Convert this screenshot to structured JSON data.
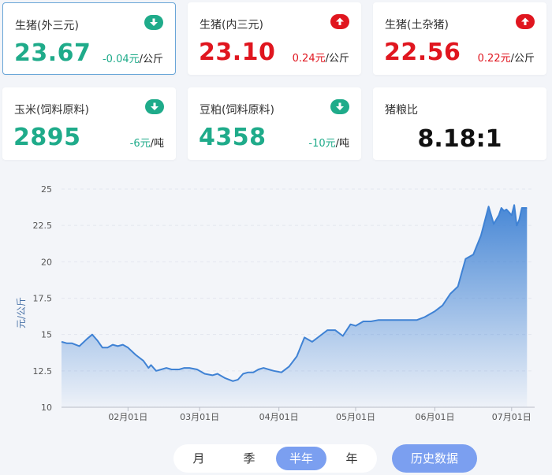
{
  "cards": [
    {
      "name": "生猪(外三元)",
      "value": "23.67",
      "change": "-0.04元",
      "unit": "/公斤",
      "trend": "down",
      "icon": "down-arrow-icon"
    },
    {
      "name": "生猪(内三元)",
      "value": "23.10",
      "change": "0.24元",
      "unit": "/公斤",
      "trend": "up",
      "icon": "up-arrow-icon"
    },
    {
      "name": "生猪(土杂猪)",
      "value": "22.56",
      "change": "0.22元",
      "unit": "/公斤",
      "trend": "up",
      "icon": "up-arrow-icon"
    },
    {
      "name": "玉米(饲料原料)",
      "value": "2895",
      "change": "-6元",
      "unit": "/吨",
      "trend": "down",
      "icon": "down-arrow-icon"
    },
    {
      "name": "豆粕(饲料原料)",
      "value": "4358",
      "change": "-10元",
      "unit": "/吨",
      "trend": "down",
      "icon": "down-arrow-icon"
    },
    {
      "name": "猪粮比",
      "value": "8.18:1"
    }
  ],
  "colors": {
    "up": "#e0161f",
    "down": "#1fab8a",
    "line": "#3f82d4",
    "accent": "#7b9ff0"
  },
  "chart_data": {
    "type": "area",
    "title": "",
    "xlabel": "",
    "ylabel": "元/公斤",
    "ylim": [
      10,
      25
    ],
    "yticks": [
      "10",
      "12.5",
      "15",
      "17.5",
      "20",
      "22.5",
      "25"
    ],
    "xticks": [
      {
        "label": "02月01日",
        "date": "2022-02-01"
      },
      {
        "label": "03月01日",
        "date": "2022-03-01"
      },
      {
        "label": "04月01日",
        "date": "2022-04-01"
      },
      {
        "label": "05月01日",
        "date": "2022-05-01"
      },
      {
        "label": "06月01日",
        "date": "2022-06-01"
      },
      {
        "label": "07月01日",
        "date": "2022-07-01"
      }
    ],
    "grid": true,
    "x": [
      "2022-01-06",
      "2022-01-08",
      "2022-01-10",
      "2022-01-13",
      "2022-01-16",
      "2022-01-18",
      "2022-01-20",
      "2022-01-22",
      "2022-01-24",
      "2022-01-26",
      "2022-01-28",
      "2022-01-30",
      "2022-02-01",
      "2022-02-04",
      "2022-02-07",
      "2022-02-09",
      "2022-02-10",
      "2022-02-12",
      "2022-02-14",
      "2022-02-16",
      "2022-02-18",
      "2022-02-19",
      "2022-02-21",
      "2022-02-23",
      "2022-02-25",
      "2022-02-28",
      "2022-03-03",
      "2022-03-06",
      "2022-03-08",
      "2022-03-11",
      "2022-03-14",
      "2022-03-16",
      "2022-03-18",
      "2022-03-20",
      "2022-03-22",
      "2022-03-24",
      "2022-03-26",
      "2022-03-28",
      "2022-03-30",
      "2022-04-02",
      "2022-04-05",
      "2022-04-08",
      "2022-04-11",
      "2022-04-14",
      "2022-04-17",
      "2022-04-20",
      "2022-04-23",
      "2022-04-26",
      "2022-04-29",
      "2022-05-01",
      "2022-05-04",
      "2022-05-07",
      "2022-05-10",
      "2022-05-13",
      "2022-05-16",
      "2022-05-19",
      "2022-05-22",
      "2022-05-25",
      "2022-05-28",
      "2022-06-01",
      "2022-06-04",
      "2022-06-07",
      "2022-06-10",
      "2022-06-13",
      "2022-06-16",
      "2022-06-19",
      "2022-06-22",
      "2022-06-24",
      "2022-06-26",
      "2022-06-27",
      "2022-06-28",
      "2022-06-29",
      "2022-07-01",
      "2022-07-02",
      "2022-07-03",
      "2022-07-04",
      "2022-07-05",
      "2022-07-06",
      "2022-07-07"
    ],
    "series": [
      {
        "values": [
          14.5,
          14.4,
          14.4,
          14.2,
          14.7,
          15.0,
          14.6,
          14.1,
          14.1,
          14.3,
          14.2,
          14.3,
          14.1,
          13.6,
          13.2,
          12.7,
          12.9,
          12.5,
          12.6,
          12.7,
          12.6,
          12.6,
          12.6,
          12.7,
          12.7,
          12.6,
          12.3,
          12.2,
          12.3,
          12.0,
          11.8,
          11.9,
          12.3,
          12.4,
          12.4,
          12.6,
          12.7,
          12.6,
          12.5,
          12.4,
          12.8,
          13.5,
          14.8,
          14.5,
          14.9,
          15.3,
          15.3,
          14.9,
          15.7,
          15.6,
          15.9,
          15.9,
          16.0,
          16.0,
          16.0,
          16.0,
          16.0,
          16.0,
          16.2,
          16.6,
          17.0,
          17.8,
          18.3,
          20.2,
          20.5,
          21.8,
          23.8,
          22.6,
          23.2,
          23.7,
          23.5,
          23.6,
          23.2,
          23.9,
          22.5,
          22.9,
          23.7,
          23.7,
          23.7
        ]
      }
    ]
  },
  "tabs": [
    "月",
    "季",
    "半年",
    "年"
  ],
  "active_tab": 2,
  "history_button": "历史数据"
}
